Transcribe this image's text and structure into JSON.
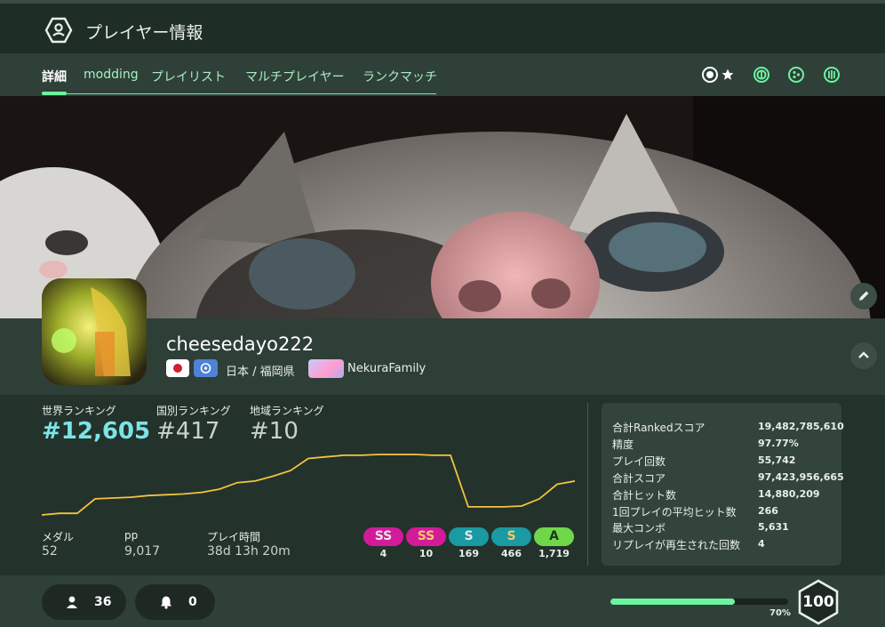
{
  "header": {
    "title": "プレイヤー情報"
  },
  "tabs": [
    {
      "label": "詳細"
    },
    {
      "label": "modding"
    },
    {
      "label": "プレイリスト"
    },
    {
      "label": "マルチプレイヤー"
    },
    {
      "label": "ランクマッチ"
    }
  ],
  "mode_icons": [
    "osu-standard-icon",
    "favorite-star-icon",
    "taiko-icon",
    "catch-icon",
    "mania-icon"
  ],
  "profile": {
    "username": "cheesedayo222",
    "location": "日本 / 福岡県",
    "team": "NekuraFamily"
  },
  "rankings": {
    "world_label": "世界ランキング",
    "world_value": "#12,605",
    "country_label": "国別ランキング",
    "country_value": "#417",
    "region_label": "地域ランキング",
    "region_value": "#10"
  },
  "chart_data": {
    "type": "line",
    "title": "",
    "xlabel": "",
    "ylabel": "",
    "series": [
      {
        "values": [
          0,
          2,
          2,
          20,
          21,
          22,
          24,
          25,
          26,
          28,
          32,
          40,
          42,
          48,
          55,
          70,
          72,
          74,
          74,
          75,
          75,
          75,
          74,
          74,
          10,
          10,
          10,
          11,
          20,
          38,
          42
        ]
      }
    ],
    "color": "#f3c340"
  },
  "meta": {
    "medals_label": "メダル",
    "medals_value": "52",
    "pp_label": "pp",
    "pp_value": "9,017",
    "playtime_label": "プレイ時間",
    "playtime_value": "38d 13h 20m"
  },
  "grades": [
    {
      "label": "SS",
      "count": "4",
      "bg": "#d21a9a",
      "fg": "#e7e7e7"
    },
    {
      "label": "SS",
      "count": "10",
      "bg": "#d21a9a",
      "fg": "#f3c86a"
    },
    {
      "label": "S",
      "count": "169",
      "bg": "#1a9aa3",
      "fg": "#e7e7e7"
    },
    {
      "label": "S",
      "count": "466",
      "bg": "#1a9aa3",
      "fg": "#f3c86a"
    },
    {
      "label": "A",
      "count": "1,719",
      "bg": "#6fd84a",
      "fg": "#1a3a18"
    }
  ],
  "summary": [
    {
      "label": "合計Rankedスコア",
      "value": "19,482,785,610"
    },
    {
      "label": "精度",
      "value": "97.77%"
    },
    {
      "label": "プレイ回数",
      "value": "55,742"
    },
    {
      "label": "合計スコア",
      "value": "97,423,956,665"
    },
    {
      "label": "合計ヒット数",
      "value": "14,880,209"
    },
    {
      "label": "1回プレイの平均ヒット数",
      "value": "266"
    },
    {
      "label": "最大コンボ",
      "value": "5,631"
    },
    {
      "label": "リプレイが再生された回数",
      "value": "4"
    }
  ],
  "footer": {
    "followers": "36",
    "subscribers": "0",
    "level_progress": 0.7,
    "level_percent": "70%",
    "level": "100"
  },
  "colors": {
    "accent": "#6cf3a0",
    "world_rank": "#7ce4e6",
    "graph_line": "#f3c340"
  }
}
